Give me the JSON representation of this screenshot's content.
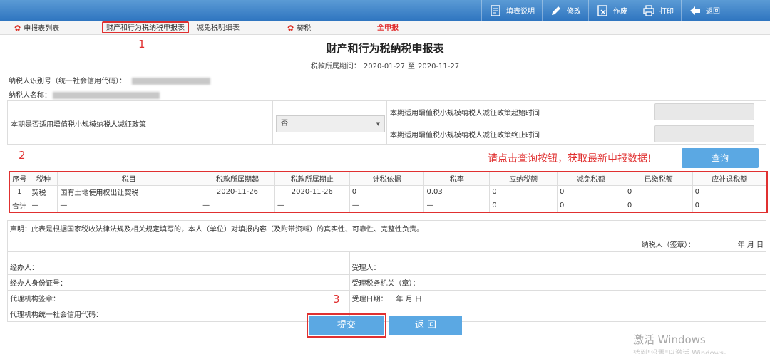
{
  "toolbar": {
    "fill_guide": "填表说明",
    "modify": "修改",
    "void": "作废",
    "print": "打印",
    "back": "返回"
  },
  "tabs": [
    {
      "label": "申报表列表"
    },
    {
      "label": "财产和行为税纳税申报表"
    },
    {
      "label": "减免税明细表"
    },
    {
      "label": "契税"
    },
    {
      "label": "全申报"
    }
  ],
  "annotations": {
    "one": "1",
    "two": "2",
    "three": "3"
  },
  "form": {
    "title": "财产和行为税纳税申报表",
    "period_label": "税款所属期间：",
    "period_start": "2020-01-27",
    "period_sep": "至",
    "period_end": "2020-11-27",
    "taxpayer_id_label": "纳税人识别号（统一社会信用代码）：",
    "taxpayer_name_label": "纳税人名称：",
    "small_scale_label": "本期是否适用增值税小规模纳税人减征政策",
    "small_scale_value": "否",
    "start_label": "本期适用增值税小规模纳税人减征政策起始时间",
    "end_label": "本期适用增值税小规模纳税人减征政策终止时间"
  },
  "notice": "请点击查询按钮，获取最新申报数据!",
  "query_button": "查询",
  "tax_table": {
    "headers": [
      "序号",
      "税种",
      "税目",
      "税款所属期起",
      "税款所属期止",
      "计税依据",
      "税率",
      "应纳税额",
      "减免税额",
      "已缴税额",
      "应补退税额"
    ],
    "rows": [
      [
        "1",
        "契税",
        "国有土地使用权出让契税",
        "2020-11-26",
        "2020-11-26",
        "0",
        "0.03",
        "0",
        "0",
        "0",
        "0"
      ]
    ],
    "total": [
      "合计",
      "—",
      "—",
      "—",
      "—",
      "—",
      "—",
      "0",
      "0",
      "0",
      "0"
    ]
  },
  "declaration": {
    "statement": "声明：此表是根据国家税收法律法规及相关规定填写的，本人（单位）对填报内容（及附带资料）的真实性、可靠性、完整性负责。",
    "taxpayer_sign": "纳税人（签章）：",
    "date_ymd": "年 月 日",
    "handler": "经办人：",
    "receiver": "受理人：",
    "handler_id": "经办人身份证号：",
    "tax_office": "受理税务机关（章）：",
    "agency_sign": "代理机构签章：",
    "receive_date": "受理日期：",
    "receive_date_ymd": "年 月 日",
    "agency_code": "代理机构统一社会信用代码："
  },
  "buttons": {
    "submit": "提交",
    "back": "返 回"
  },
  "watermark": {
    "line1": "激活 Windows",
    "line2": "转到\"设置\"以激活 Windows。"
  }
}
